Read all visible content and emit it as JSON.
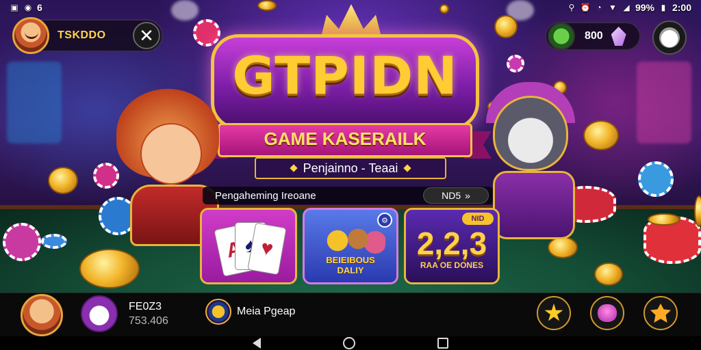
{
  "status_bar": {
    "left_text": "6",
    "battery": "99%",
    "time": "2:00"
  },
  "player": {
    "name": "TSKDDO",
    "close_symbol": "✕"
  },
  "top_right": {
    "coins": "800"
  },
  "logo": {
    "title": "GTPIDN",
    "ribbon": "GAME KASERAILK",
    "subtitle": "Penjainno - Teaai"
  },
  "panel": {
    "header": "Pengaheming Ireoane",
    "pill_value": "ND5",
    "pill_arrow": "»"
  },
  "cards": [
    {
      "name": "cards-game",
      "icons": [
        "A",
        "♠",
        "♥"
      ]
    },
    {
      "name": "characters-game",
      "label_line1": "BEIEIBOUS",
      "label_line2": "DALIY"
    },
    {
      "name": "numbers-game",
      "number": "2,2,3",
      "label": "RAA OE DONES",
      "tag": "NID"
    }
  ],
  "bottom_bar": {
    "label": "FE0Z3",
    "value": "753.406",
    "media_label": "Meia Pgeap"
  },
  "colors": {
    "accent_gold": "#f2c342",
    "logo_purple": "#7d1ea8",
    "ribbon_pink": "#e63aa6",
    "felt_green": "#1f6b4a"
  }
}
